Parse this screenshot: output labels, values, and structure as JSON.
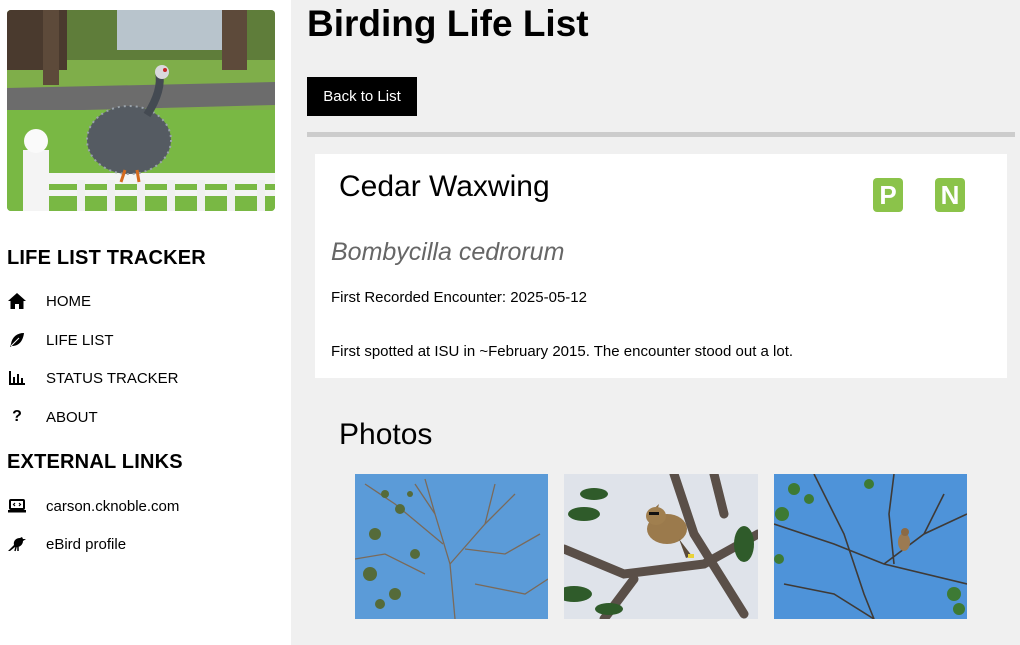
{
  "sidebar": {
    "title": "LIFE LIST TRACKER",
    "nav": [
      {
        "label": "HOME",
        "icon": "home-icon"
      },
      {
        "label": "LIFE LIST",
        "icon": "feather-icon"
      },
      {
        "label": "STATUS TRACKER",
        "icon": "bar-chart-icon"
      },
      {
        "label": "ABOUT",
        "icon": "question-icon"
      }
    ],
    "external_title": "EXTERNAL LINKS",
    "external": [
      {
        "label": "carson.cknoble.com",
        "icon": "laptop-code-icon"
      },
      {
        "label": "eBird profile",
        "icon": "crow-icon"
      }
    ]
  },
  "main": {
    "title": "Birding Life List",
    "back_label": "Back to List",
    "bird": {
      "common_name": "Cedar Waxwing",
      "badges": [
        "P",
        "N"
      ],
      "scientific_name": "Bombycilla cedrorum",
      "first_encounter": "First Recorded Encounter: 2025-05-12",
      "notes": "First spotted at ISU in ~February 2015. The encounter stood out a lot."
    },
    "photos_title": "Photos"
  },
  "colors": {
    "badge": "#8bc34a",
    "main_bg": "#f0f0f0",
    "button_bg": "#000000",
    "divider": "#cccccc",
    "scientific_name": "#666666"
  }
}
